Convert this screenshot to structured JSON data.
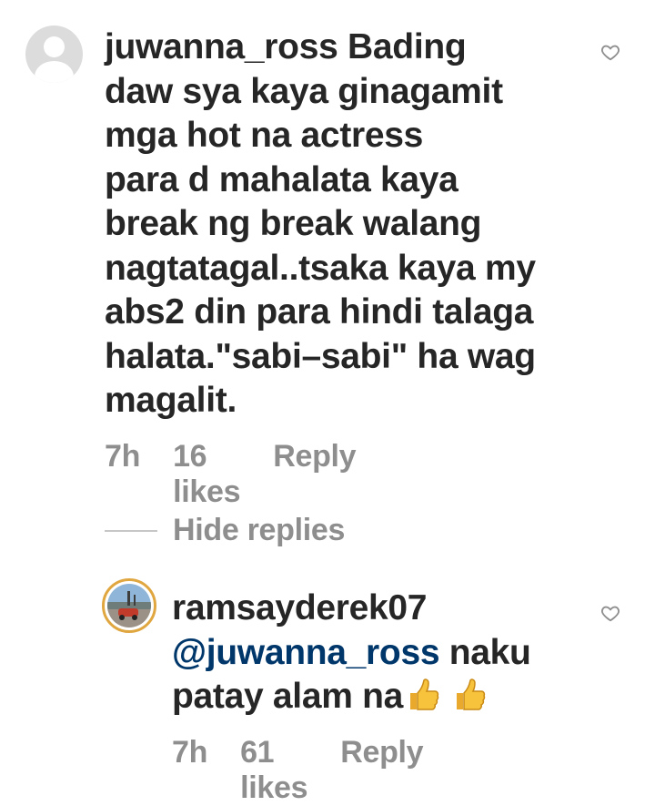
{
  "comments": [
    {
      "username": "juwanna_ross",
      "text": "Bading\ndaw sya kaya ginagamit\nmga hot na actress\npara d mahalata kaya\nbreak ng break walang\nnagtatagal..tsaka kaya my\nabs2 din para hindi talaga\nhalata.\"sabi–sabi\" ha wag\nmagalit.",
      "time": "7h",
      "likes": "16 likes",
      "reply_label": "Reply",
      "avatar_icon": "default-avatar-icon",
      "like_icon": "heart-outline-icon"
    }
  ],
  "hide_replies_label": "Hide replies",
  "replies": [
    {
      "username": "ramsayderek07",
      "mention": "@juwanna_ross",
      "text": " naku\npatay alam na",
      "emojis": [
        "thumbs-up-emoji",
        "thumbs-up-emoji"
      ],
      "time": "7h",
      "likes": "61 likes",
      "reply_label": "Reply",
      "avatar_icon": "profile-photo",
      "like_icon": "heart-outline-icon"
    }
  ],
  "colors": {
    "text_primary": "#262626",
    "text_secondary": "#8e8e8e",
    "mention": "#00376b",
    "avatar_ring": "#e0a640",
    "background": "#ffffff"
  }
}
